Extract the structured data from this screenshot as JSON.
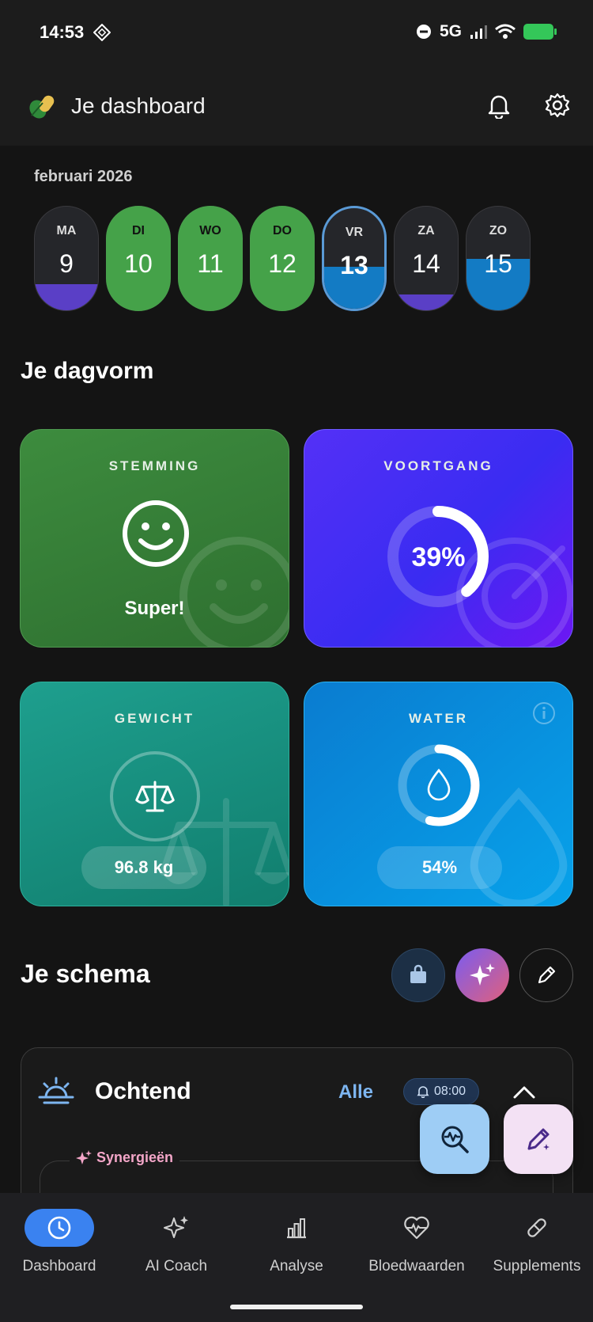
{
  "status_bar": {
    "time": "14:53",
    "network": "5G"
  },
  "header": {
    "title": "Je dashboard"
  },
  "calendar": {
    "month": "februari 2026",
    "days": [
      {
        "label": "MA",
        "number": "9",
        "fill_color": "#5a3fc6",
        "fill_fraction": 0.25,
        "style": "default"
      },
      {
        "label": "DI",
        "number": "10",
        "fill_color": "#45a249",
        "fill_fraction": 0.85,
        "style": "green"
      },
      {
        "label": "WO",
        "number": "11",
        "fill_color": "#45a249",
        "fill_fraction": 1.0,
        "style": "green"
      },
      {
        "label": "DO",
        "number": "12",
        "fill_color": "#45a249",
        "fill_fraction": 0.92,
        "style": "green"
      },
      {
        "label": "VR",
        "number": "13",
        "fill_color": "#137bc4",
        "fill_fraction": 0.42,
        "style": "selected"
      },
      {
        "label": "ZA",
        "number": "14",
        "fill_color": "#5a3fc6",
        "fill_fraction": 0.15,
        "style": "default"
      },
      {
        "label": "ZO",
        "number": "15",
        "fill_color": "#137bc4",
        "fill_fraction": 0.5,
        "style": "default"
      }
    ]
  },
  "dagvorm": {
    "heading": "Je dagvorm",
    "mood": {
      "title": "STEMMING",
      "value": "Super!"
    },
    "progress": {
      "title": "VOORTGANG",
      "value": "39%",
      "fraction": 0.39
    },
    "weight": {
      "title": "GEWICHT",
      "value": "96.8 kg"
    },
    "water": {
      "title": "WATER",
      "value": "54%",
      "fraction": 0.54
    }
  },
  "schema": {
    "heading": "Je schema",
    "section": {
      "title": "Ochtend",
      "filter_label": "Alle",
      "time": "08:00"
    },
    "synergies_label": "Synergieën"
  },
  "nav": {
    "items": [
      {
        "label": "Dashboard",
        "icon": "clock-icon",
        "active": true
      },
      {
        "label": "AI Coach",
        "icon": "sparkle-icon",
        "active": false
      },
      {
        "label": "Analyse",
        "icon": "bar-chart-icon",
        "active": false
      },
      {
        "label": "Bloedwaarden",
        "icon": "heart-pulse-icon",
        "active": false
      },
      {
        "label": "Supplements",
        "icon": "pill-icon",
        "active": false
      }
    ]
  },
  "colors": {
    "accent_blue": "#3a82f0",
    "green": "#45a249",
    "purple": "#5430f6",
    "water_blue": "#07a2ea"
  }
}
